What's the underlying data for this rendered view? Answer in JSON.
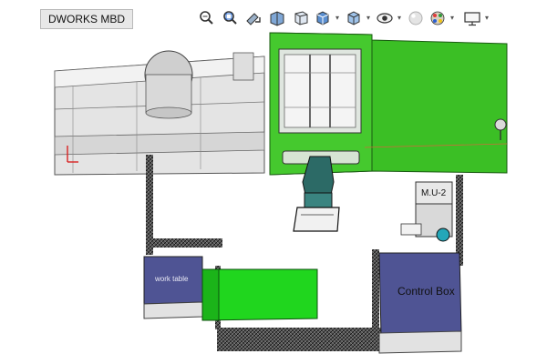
{
  "app": {
    "tab_title": "DWORKS MBD"
  },
  "toolbar": {
    "items": [
      {
        "icon": "zoom-to-fit-icon"
      },
      {
        "icon": "zoom-to-area-icon"
      },
      {
        "icon": "previous-view-icon"
      },
      {
        "icon": "section-view-icon"
      },
      {
        "icon": "view-selector-icon"
      },
      {
        "icon": "view-orientation-icon"
      },
      {
        "icon": "display-style-icon"
      },
      {
        "icon": "hide-show-items-icon"
      },
      {
        "icon": "edit-appearance-icon"
      },
      {
        "icon": "apply-scene-icon"
      },
      {
        "icon": "view-settings-icon"
      }
    ]
  },
  "model": {
    "labels": {
      "mu": "M.U-2",
      "control_box": "Control Box",
      "work_table": "work table"
    },
    "colors": {
      "machine_green": "#3bbf25",
      "conveyor_green": "#20d61e",
      "box_purple": "#4f5494",
      "machine_gray": "#e6e6e6",
      "fence_dark": "#2c2c2c"
    }
  }
}
